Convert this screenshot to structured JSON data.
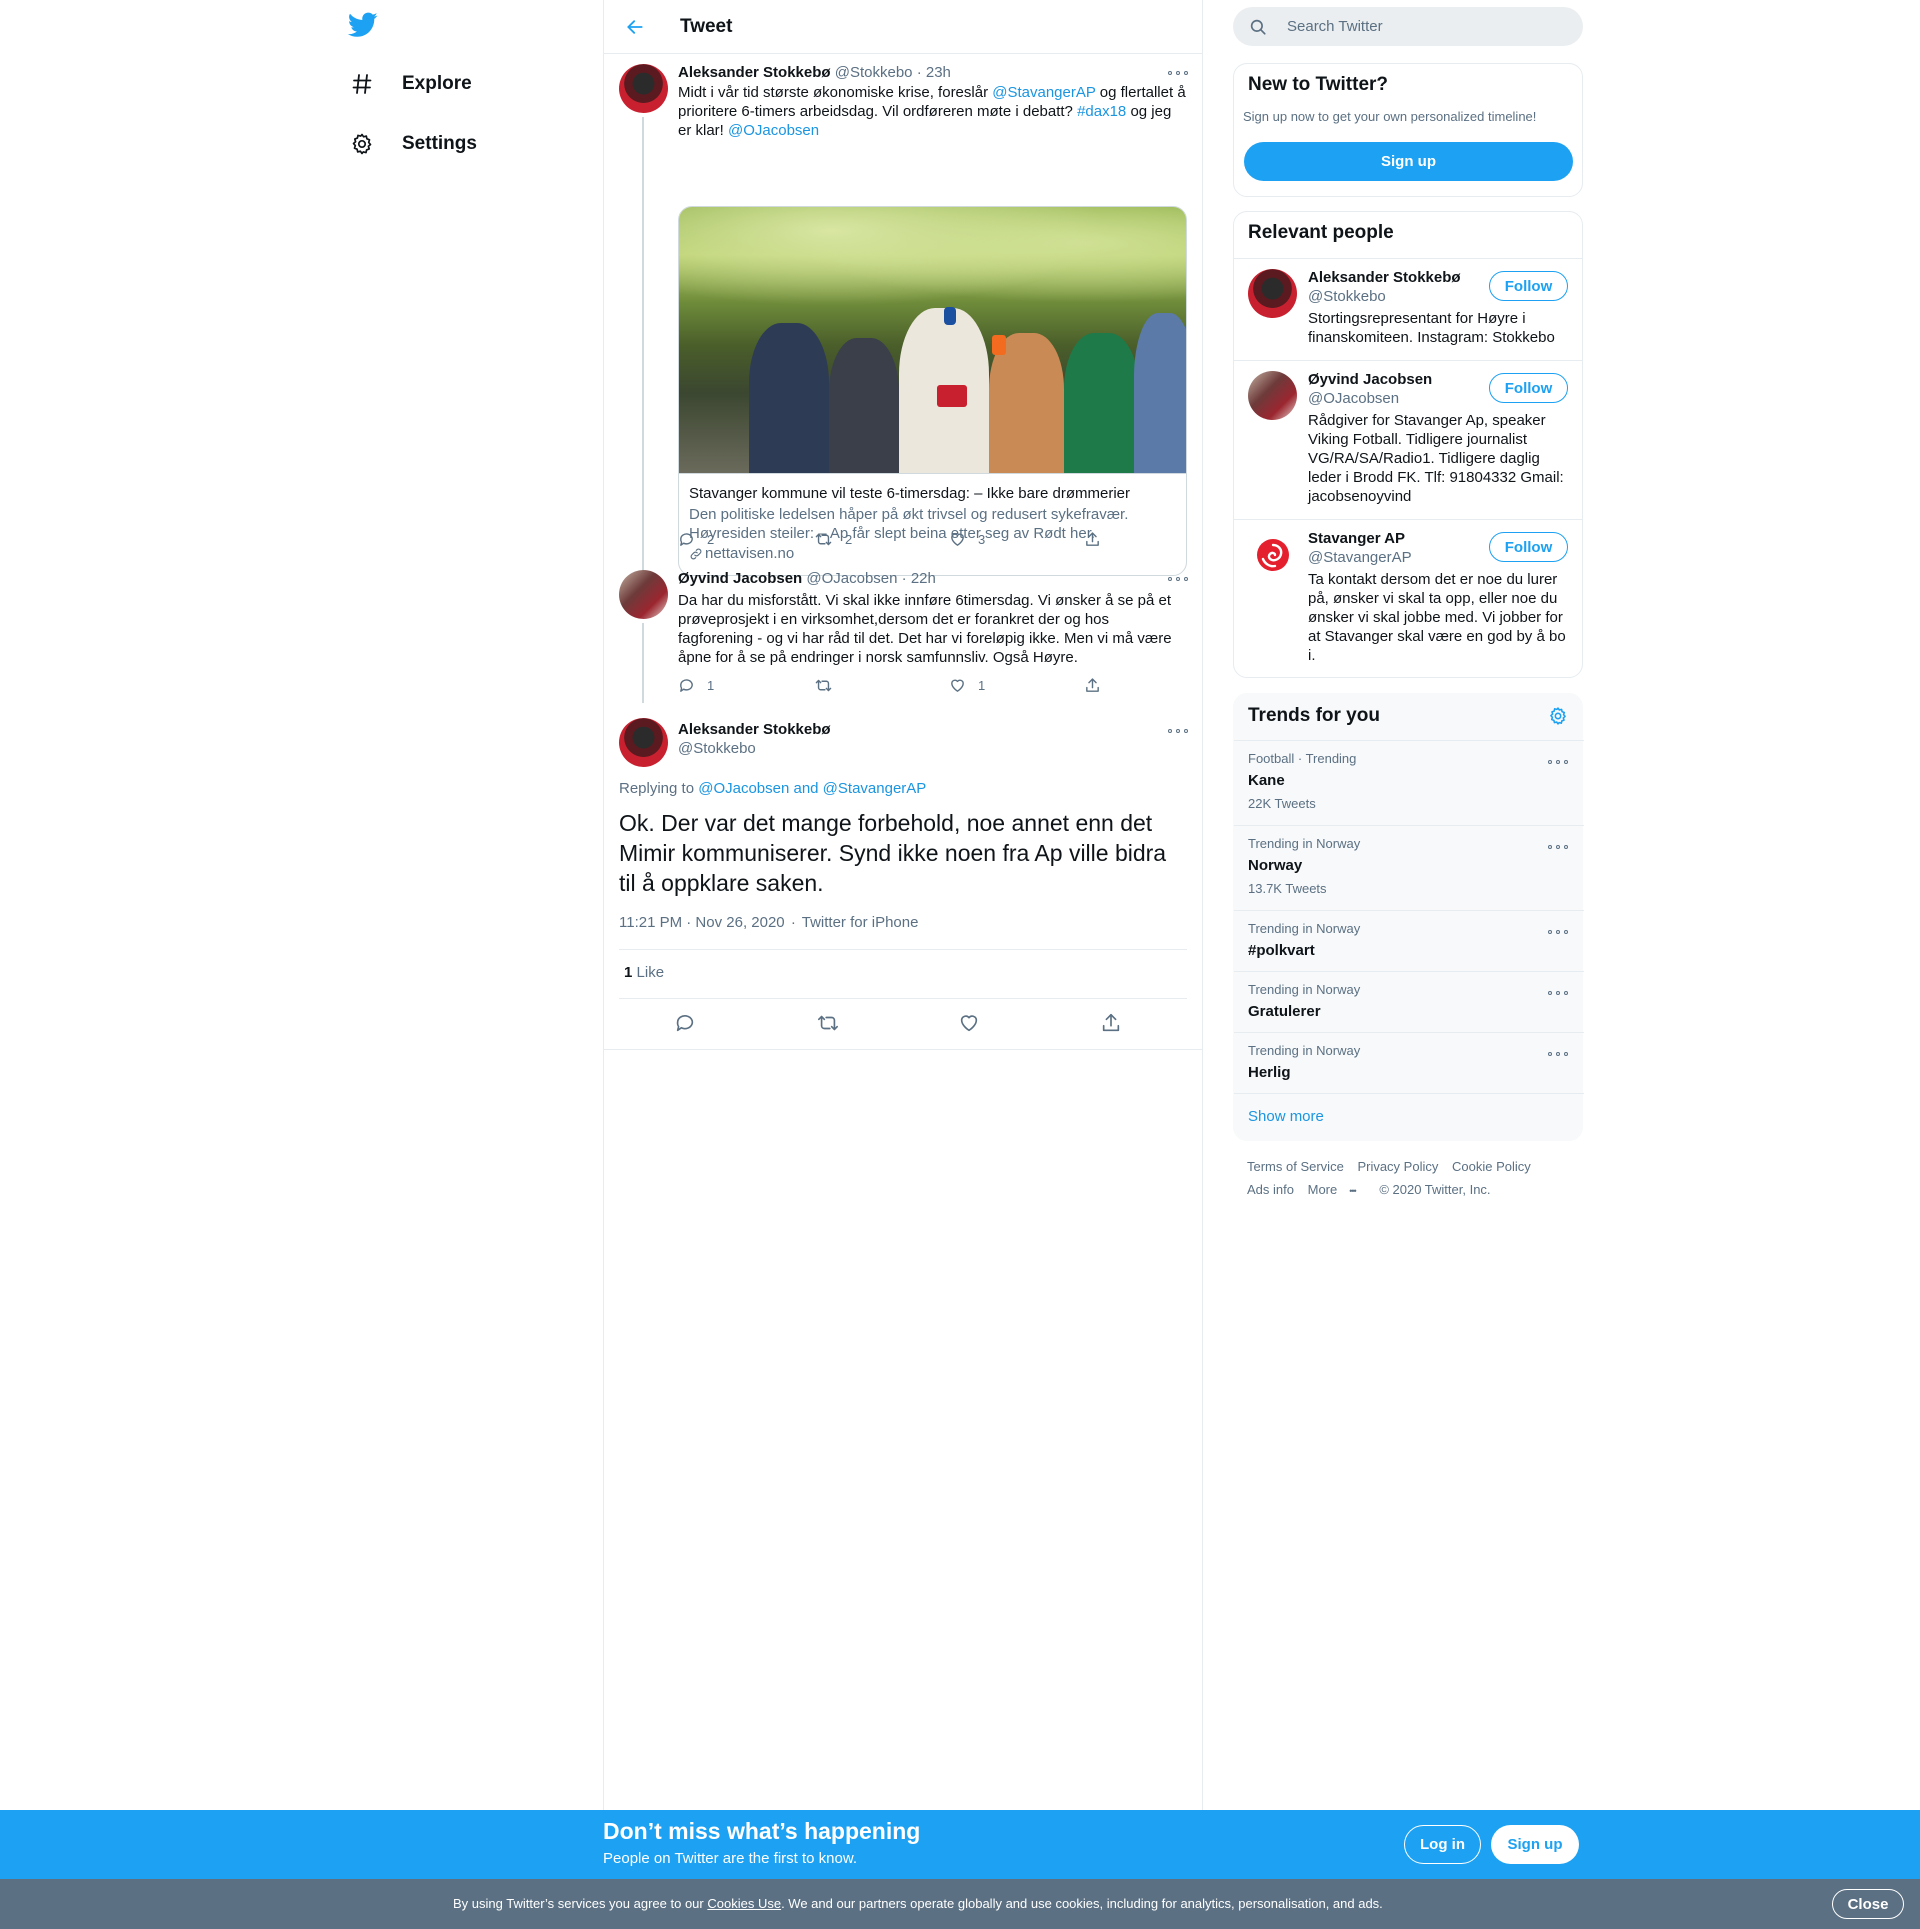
{
  "leftnav": {
    "items": [
      {
        "label": "Explore",
        "icon": "hashtag-icon"
      },
      {
        "label": "Settings",
        "icon": "gear-icon"
      }
    ]
  },
  "header": {
    "title": "Tweet"
  },
  "tweets": [
    {
      "name": "Aleksander Stokkebø",
      "handle": "@Stokkebo",
      "time": "· 23h",
      "text_parts": [
        "Midt i vår tid største økonomiske krise, foreslår ",
        "@StavangerAP",
        " og flertallet å prioritere 6-timers arbeidsdag. Vil ordføreren møte i debatt? ",
        "#dax18",
        " og jeg er klar! ",
        "@OJacobsen"
      ],
      "card": {
        "title": "Stavanger kommune vil teste 6-timersdag: – Ikke bare drømmerier",
        "description": "Den politiske ledelsen håper på økt trivsel og redusert sykefravær. Høyresiden steiler: – Ap får slept beina etter seg av Rødt her.",
        "domain": "nettavisen.no"
      },
      "counts": {
        "reply": "2",
        "retweet": "2",
        "like": "3"
      }
    },
    {
      "name": "Øyvind Jacobsen",
      "handle": "@OJacobsen",
      "time": "· 22h",
      "text": "Da har du misforstått. Vi skal ikke innføre 6timersdag. Vi ønsker å se på et prøveprosjekt i en virksomhet,dersom det er forankret der og hos fagforening - og vi har råd til det. Det har vi foreløpig ikke. Men vi må være åpne for å se på endringer i norsk samfunnsliv. Også Høyre.",
      "counts": {
        "reply": "1",
        "retweet": "",
        "like": "1"
      }
    }
  ],
  "main_tweet": {
    "name": "Aleksander Stokkebø",
    "handle": "@Stokkebo",
    "replying_label": "Replying to",
    "replying_targets": "@OJacobsen and @StavangerAP",
    "text": "Ok. Der var det mange forbehold, noe annet enn det Mimir kommuniserer. Synd ikke noen fra Ap ville bidra til å oppklare saken.",
    "timestamp": "11:21 PM · Nov 26, 2020",
    "source": "Twitter for iPhone",
    "likes_count": "1",
    "likes_label": "Like"
  },
  "search": {
    "placeholder": "Search Twitter"
  },
  "new_to_twitter": {
    "title": "New to Twitter?",
    "subtitle": "Sign up now to get your own personalized timeline!",
    "button": "Sign up"
  },
  "relevant_people": {
    "title": "Relevant people",
    "follow_label": "Follow",
    "people": [
      {
        "name": "Aleksander Stokkebø",
        "handle": "@Stokkebo",
        "bio": "Stortingsrepresentant for Høyre i finanskomiteen. Instagram: Stokkebo"
      },
      {
        "name": "Øyvind Jacobsen",
        "handle": "@OJacobsen",
        "bio": "Rådgiver for Stavanger Ap, speaker Viking Fotball. Tidligere journalist VG/RA/SA/Radio1. Tidligere daglig leder i Brodd FK. Tlf: 91804332 Gmail: jacobsenoyvind"
      },
      {
        "name": "Stavanger AP",
        "handle": "@StavangerAP",
        "bio": "Ta kontakt dersom det er noe du lurer på, ønsker vi skal ta opp, eller noe du ønsker vi skal jobbe med. Vi jobber for at Stavanger skal være en god by å bo i."
      }
    ]
  },
  "trends": {
    "title": "Trends for you",
    "items": [
      {
        "context": "Football · Trending",
        "name": "Kane",
        "count": "22K Tweets"
      },
      {
        "context": "Trending in Norway",
        "name": "Norway",
        "count": "13.7K Tweets"
      },
      {
        "context": "Trending in Norway",
        "name": "#polkvart",
        "count": ""
      },
      {
        "context": "Trending in Norway",
        "name": "Gratulerer",
        "count": ""
      },
      {
        "context": "Trending in Norway",
        "name": "Herlig",
        "count": ""
      }
    ],
    "show_more": "Show more"
  },
  "footer": {
    "terms": "Terms of Service",
    "privacy": "Privacy Policy",
    "cookie": "Cookie Policy",
    "ads": "Ads info",
    "more": "More",
    "copyright": "© 2020 Twitter, Inc."
  },
  "bottom_bar": {
    "title": "Don’t miss what’s happening",
    "subtitle": "People on Twitter are the first to know.",
    "login": "Log in",
    "signup": "Sign up"
  },
  "cookie_bar": {
    "text_before": "By using Twitter’s services you agree to our ",
    "link": "Cookies Use",
    "text_after": ". We and our partners operate globally and use cookies, including for analytics, personalisation, and ads.",
    "close": "Close"
  },
  "colors": {
    "accent": "#1da1f2",
    "text": "#0f1419",
    "secondary": "#5b7083",
    "border": "#e6ecf0"
  }
}
